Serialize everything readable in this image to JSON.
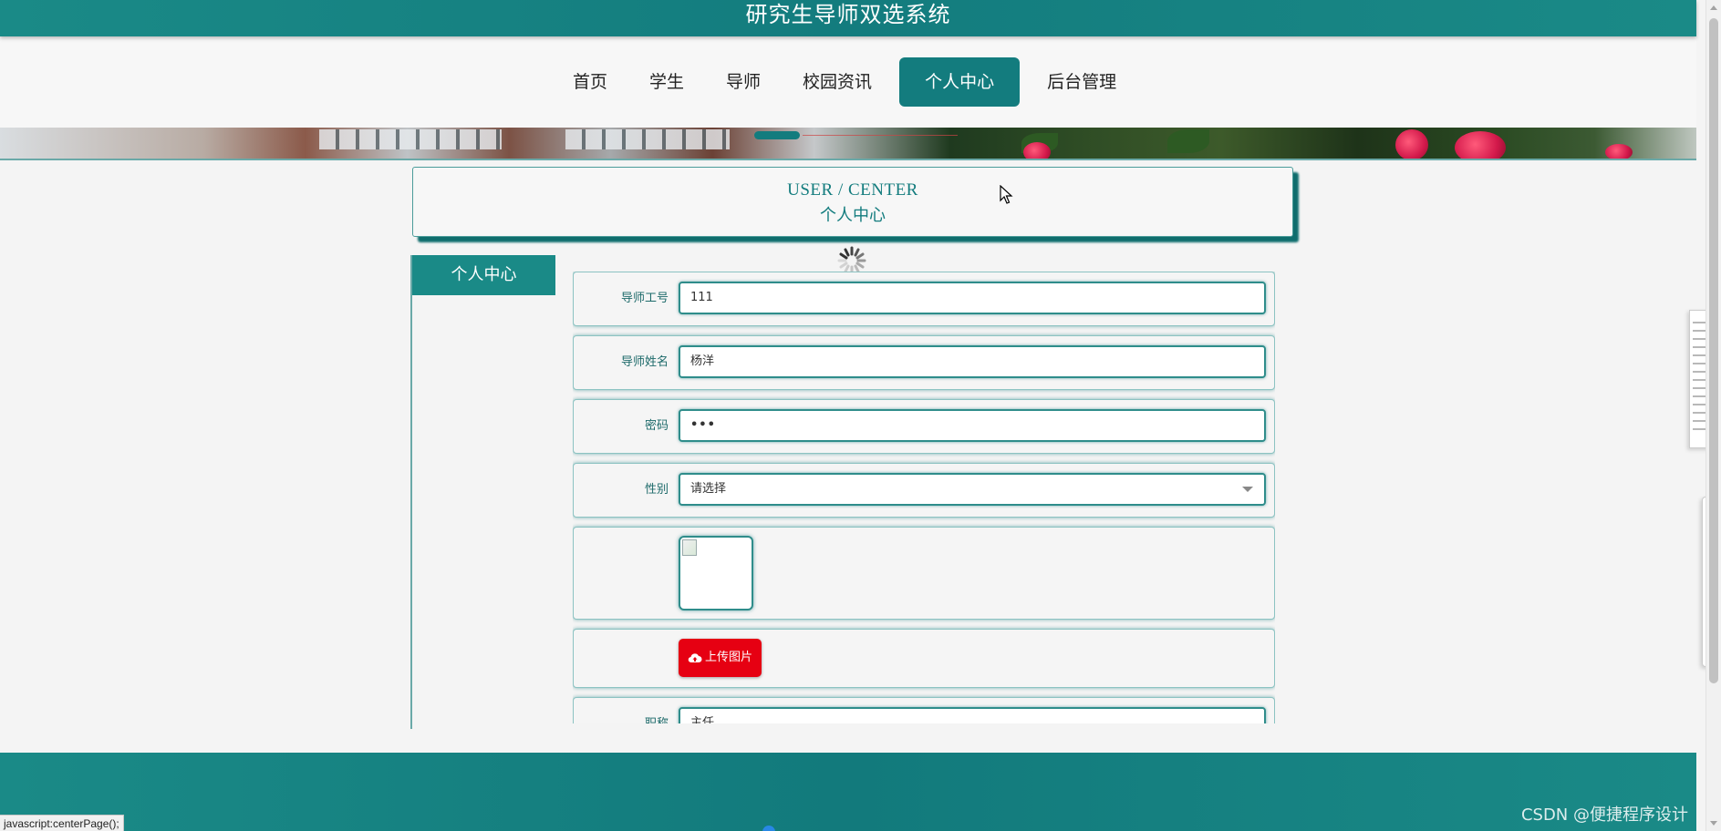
{
  "site": {
    "title": "研究生导师双选系统"
  },
  "nav": {
    "items": [
      {
        "label": "首页"
      },
      {
        "label": "学生"
      },
      {
        "label": "导师"
      },
      {
        "label": "校园资讯"
      },
      {
        "label": "个人中心",
        "active": true
      },
      {
        "label": "后台管理"
      }
    ]
  },
  "user_center": {
    "en_title": "USER / CENTER",
    "cn_title": "个人中心"
  },
  "side_menu": {
    "title": "个人中心"
  },
  "form": {
    "tutor_id": {
      "label": "导师工号",
      "value": "111"
    },
    "tutor_name": {
      "label": "导师姓名",
      "value": "杨洋"
    },
    "password": {
      "label": "密码",
      "value": "•••"
    },
    "gender": {
      "label": "性别",
      "value": "请选择"
    },
    "upload": {
      "label": "上传图片"
    },
    "title_field": {
      "label": "职称",
      "value": "主任"
    }
  },
  "footer": {
    "watermark": "CSDN @便捷程序设计"
  },
  "status_bar": {
    "link": "javascript:centerPage();"
  },
  "colors": {
    "primary": "#137c7e",
    "primary_light": "#1a8a87",
    "upload_button": "#e60012",
    "background": "#f4f4f4"
  }
}
